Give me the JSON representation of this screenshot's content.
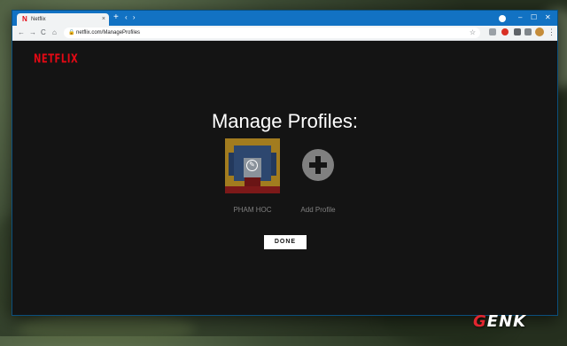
{
  "browser": {
    "tab_title": "Netflix",
    "tab_favicon": "N",
    "tab_close": "×",
    "new_tab": "+",
    "tab_nav": "‹ ›",
    "url": "netflix.com/ManageProfiles",
    "window_controls": {
      "minimize": "–",
      "maximize": "☐",
      "close": "✕"
    },
    "nav_icons": {
      "back": "←",
      "forward": "→",
      "reload": "C",
      "home": "⌂",
      "lock": "🔒",
      "star": "☆",
      "menu": "⋮"
    }
  },
  "page": {
    "logo": "NETFLIX",
    "heading": "Manage Profiles:",
    "profiles": [
      {
        "name": "PHAM HOC",
        "edit_icon": "✎"
      }
    ],
    "add_profile_label": "Add Profile",
    "done_label": "DONE"
  },
  "watermark": {
    "prefix": "G",
    "rest": "ENK"
  },
  "colors": {
    "netflix_red": "#e50914",
    "page_bg": "#141414",
    "titlebar": "#1272c3",
    "muted_text": "#808080"
  }
}
